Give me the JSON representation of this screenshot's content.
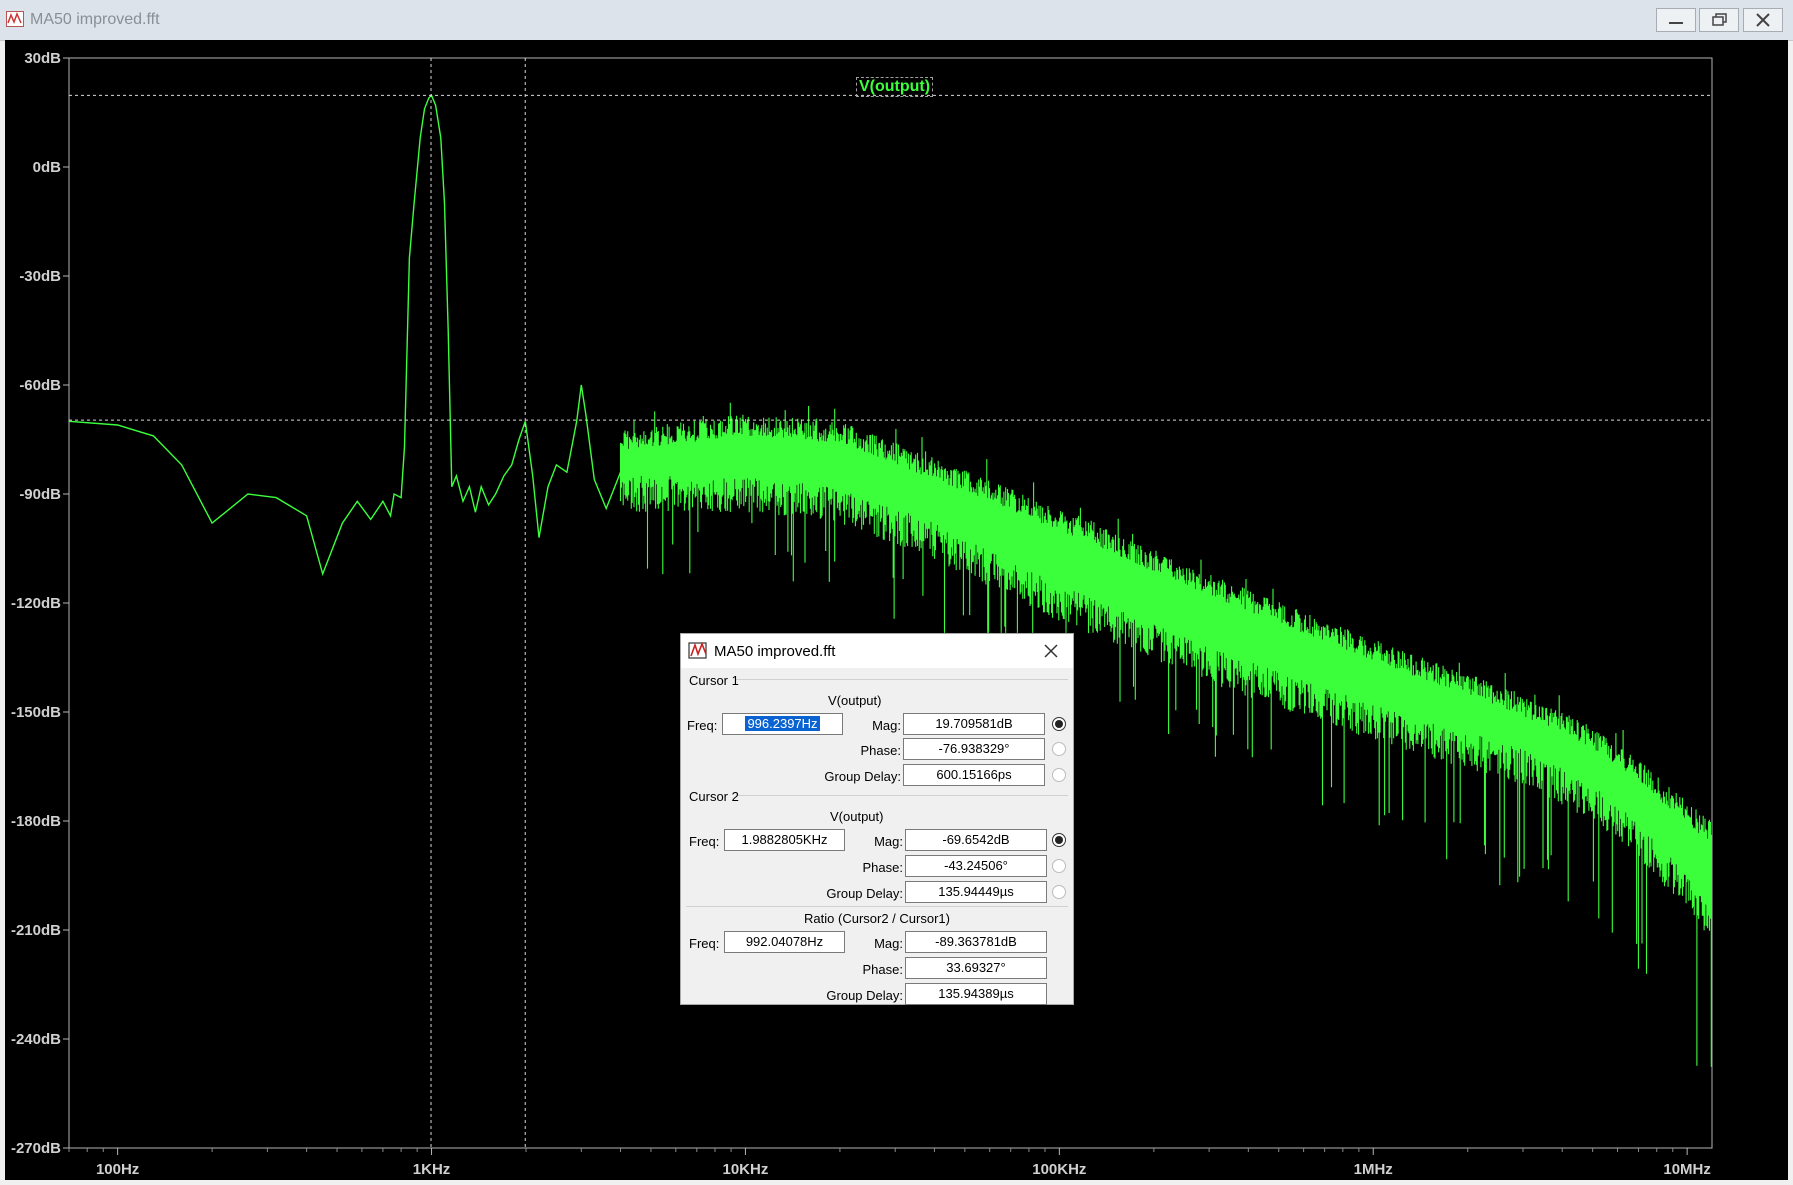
{
  "window": {
    "title": "MA50 improved.fft",
    "controls": [
      "minimize",
      "restore",
      "close"
    ]
  },
  "trace": {
    "name": "V(output)",
    "color": "#3cff3c"
  },
  "chart_data": {
    "type": "line",
    "title": "",
    "xlabel": "",
    "ylabel": "",
    "x_scale": "log",
    "xlim": [
      70,
      12000000
    ],
    "ylim": [
      -270,
      30
    ],
    "x_ticks": [
      "100Hz",
      "1KHz",
      "10KHz",
      "100KHz",
      "1MHz",
      "10MHz"
    ],
    "y_ticks": [
      "30dB",
      "0dB",
      "-30dB",
      "-60dB",
      "-90dB",
      "-120dB",
      "-150dB",
      "-180dB",
      "-210dB",
      "-240dB",
      "-270dB"
    ],
    "y_tick_values": [
      30,
      0,
      -30,
      -60,
      -90,
      -120,
      -150,
      -180,
      -210,
      -240,
      -270
    ],
    "series": [
      {
        "color": "#3cff3c",
        "x": [
          70,
          100,
          130,
          160,
          200,
          260,
          320,
          400,
          450,
          520,
          580,
          640,
          700,
          740,
          760,
          800,
          820,
          850,
          880,
          920,
          950,
          980,
          1000,
          1030,
          1070,
          1100,
          1130,
          1160,
          1200,
          1260,
          1320,
          1380,
          1440,
          1520,
          1600,
          1700,
          1800,
          1900,
          1990,
          2100,
          2200,
          2350,
          2500,
          2700,
          2900,
          3000,
          3100,
          3300,
          3600,
          4000
        ],
        "y": [
          -70,
          -71,
          -74,
          -82,
          -98,
          -90,
          -91,
          -96,
          -112,
          -98,
          -92,
          -97,
          -92,
          -96,
          -90,
          -91,
          -77,
          -25,
          -10,
          8,
          16,
          19,
          19.7,
          17,
          8,
          -10,
          -45,
          -88,
          -85,
          -92,
          -88,
          -95,
          -88,
          -93,
          -90,
          -85,
          -82,
          -75,
          -70,
          -85,
          -102,
          -88,
          -82,
          -84,
          -70,
          -60,
          -68,
          -86,
          -94,
          -84
        ]
      }
    ],
    "noise_band": {
      "x": [
        4000,
        10000,
        20000,
        40000,
        100000,
        300000,
        1000000,
        3000000,
        5000000,
        7000000,
        10000000,
        12000000
      ],
      "top": [
        -72,
        -68,
        -70,
        -80,
        -94,
        -112,
        -130,
        -145,
        -154,
        -163,
        -175,
        -180
      ],
      "bottom": [
        -95,
        -95,
        -98,
        -108,
        -125,
        -142,
        -158,
        -170,
        -180,
        -190,
        -205,
        -215
      ],
      "spike_min": [
        -115,
        -112,
        -118,
        -130,
        -150,
        -165,
        -185,
        -200,
        -210,
        -225,
        -245,
        -252
      ]
    },
    "cursors": [
      {
        "name": "Cursor 1",
        "x": 996.2397,
        "y": 19.709581
      },
      {
        "name": "Cursor 2",
        "x": 1988.2805,
        "y": -69.6542
      }
    ]
  },
  "dialog": {
    "title": "MA50 improved.fft",
    "cursor1": {
      "header": "Cursor 1",
      "trace": "V(output)",
      "freq_label": "Freq:",
      "freq": "996.2397Hz",
      "mag_label": "Mag:",
      "mag": "19.709581dB",
      "phase_label": "Phase:",
      "phase": "-76.938329°",
      "gd_label": "Group Delay:",
      "gd": "600.15166ps"
    },
    "cursor2": {
      "header": "Cursor 2",
      "trace": "V(output)",
      "freq_label": "Freq:",
      "freq": "1.9882805KHz",
      "mag_label": "Mag:",
      "mag": "-69.6542dB",
      "phase_label": "Phase:",
      "phase": "-43.24506°",
      "gd_label": "Group Delay:",
      "gd": "135.94449µs"
    },
    "ratio": {
      "header": "Ratio (Cursor2 / Cursor1)",
      "freq_label": "Freq:",
      "freq": "992.04078Hz",
      "mag_label": "Mag:",
      "mag": "-89.363781dB",
      "phase_label": "Phase:",
      "phase": "33.69327°",
      "gd_label": "Group Delay:",
      "gd": "135.94389µs"
    }
  }
}
